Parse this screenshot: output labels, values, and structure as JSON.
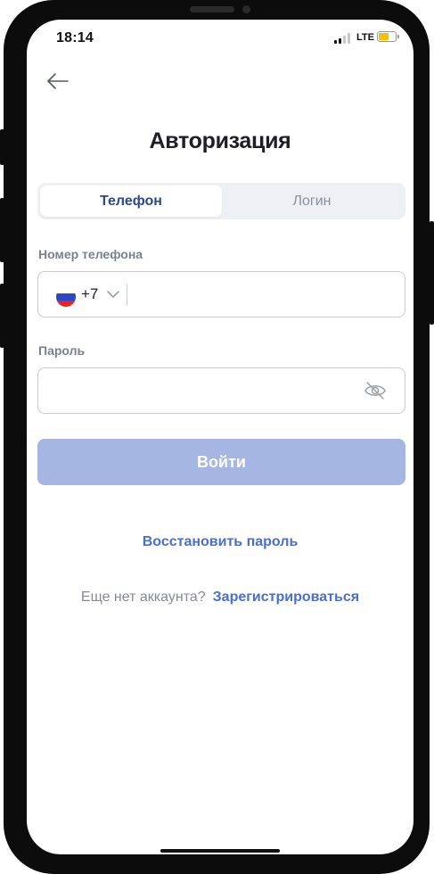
{
  "status_bar": {
    "time": "18:14",
    "network": "LTE",
    "battery_color": "#f3c200"
  },
  "header": {
    "back_icon": "arrow-left-icon",
    "title": "Авторизация"
  },
  "tabs": {
    "active": "Телефон",
    "inactive": "Логин"
  },
  "phone_field": {
    "label": "Номер телефона",
    "country_flag": "russia-flag",
    "country_code": "+7",
    "value": ""
  },
  "password_field": {
    "label": "Пароль",
    "value": "",
    "visibility_icon": "eye-slash-icon"
  },
  "login_button": {
    "label": "Войти",
    "color": "#a5b6e3"
  },
  "restore_link": "Восстановить пароль",
  "register": {
    "question": "Еще нет аккаунта?",
    "link": "Зарегистрироваться"
  },
  "colors": {
    "accent": "#4a70cc",
    "tab_active_text": "#2a4a8c"
  }
}
